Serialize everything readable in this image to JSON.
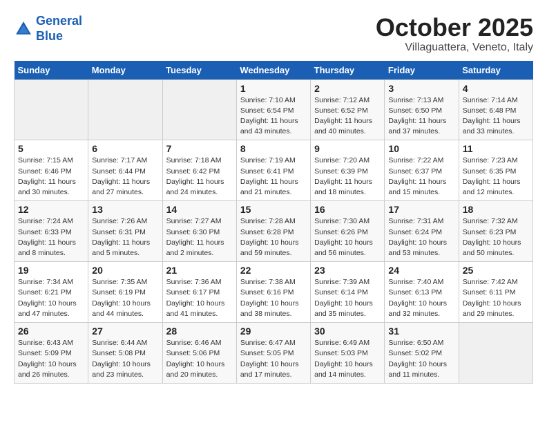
{
  "header": {
    "logo_line1": "General",
    "logo_line2": "Blue",
    "month": "October 2025",
    "location": "Villaguattera, Veneto, Italy"
  },
  "weekdays": [
    "Sunday",
    "Monday",
    "Tuesday",
    "Wednesday",
    "Thursday",
    "Friday",
    "Saturday"
  ],
  "weeks": [
    [
      {
        "day": "",
        "info": ""
      },
      {
        "day": "",
        "info": ""
      },
      {
        "day": "",
        "info": ""
      },
      {
        "day": "1",
        "info": "Sunrise: 7:10 AM\nSunset: 6:54 PM\nDaylight: 11 hours and 43 minutes."
      },
      {
        "day": "2",
        "info": "Sunrise: 7:12 AM\nSunset: 6:52 PM\nDaylight: 11 hours and 40 minutes."
      },
      {
        "day": "3",
        "info": "Sunrise: 7:13 AM\nSunset: 6:50 PM\nDaylight: 11 hours and 37 minutes."
      },
      {
        "day": "4",
        "info": "Sunrise: 7:14 AM\nSunset: 6:48 PM\nDaylight: 11 hours and 33 minutes."
      }
    ],
    [
      {
        "day": "5",
        "info": "Sunrise: 7:15 AM\nSunset: 6:46 PM\nDaylight: 11 hours and 30 minutes."
      },
      {
        "day": "6",
        "info": "Sunrise: 7:17 AM\nSunset: 6:44 PM\nDaylight: 11 hours and 27 minutes."
      },
      {
        "day": "7",
        "info": "Sunrise: 7:18 AM\nSunset: 6:42 PM\nDaylight: 11 hours and 24 minutes."
      },
      {
        "day": "8",
        "info": "Sunrise: 7:19 AM\nSunset: 6:41 PM\nDaylight: 11 hours and 21 minutes."
      },
      {
        "day": "9",
        "info": "Sunrise: 7:20 AM\nSunset: 6:39 PM\nDaylight: 11 hours and 18 minutes."
      },
      {
        "day": "10",
        "info": "Sunrise: 7:22 AM\nSunset: 6:37 PM\nDaylight: 11 hours and 15 minutes."
      },
      {
        "day": "11",
        "info": "Sunrise: 7:23 AM\nSunset: 6:35 PM\nDaylight: 11 hours and 12 minutes."
      }
    ],
    [
      {
        "day": "12",
        "info": "Sunrise: 7:24 AM\nSunset: 6:33 PM\nDaylight: 11 hours and 8 minutes."
      },
      {
        "day": "13",
        "info": "Sunrise: 7:26 AM\nSunset: 6:31 PM\nDaylight: 11 hours and 5 minutes."
      },
      {
        "day": "14",
        "info": "Sunrise: 7:27 AM\nSunset: 6:30 PM\nDaylight: 11 hours and 2 minutes."
      },
      {
        "day": "15",
        "info": "Sunrise: 7:28 AM\nSunset: 6:28 PM\nDaylight: 10 hours and 59 minutes."
      },
      {
        "day": "16",
        "info": "Sunrise: 7:30 AM\nSunset: 6:26 PM\nDaylight: 10 hours and 56 minutes."
      },
      {
        "day": "17",
        "info": "Sunrise: 7:31 AM\nSunset: 6:24 PM\nDaylight: 10 hours and 53 minutes."
      },
      {
        "day": "18",
        "info": "Sunrise: 7:32 AM\nSunset: 6:23 PM\nDaylight: 10 hours and 50 minutes."
      }
    ],
    [
      {
        "day": "19",
        "info": "Sunrise: 7:34 AM\nSunset: 6:21 PM\nDaylight: 10 hours and 47 minutes."
      },
      {
        "day": "20",
        "info": "Sunrise: 7:35 AM\nSunset: 6:19 PM\nDaylight: 10 hours and 44 minutes."
      },
      {
        "day": "21",
        "info": "Sunrise: 7:36 AM\nSunset: 6:17 PM\nDaylight: 10 hours and 41 minutes."
      },
      {
        "day": "22",
        "info": "Sunrise: 7:38 AM\nSunset: 6:16 PM\nDaylight: 10 hours and 38 minutes."
      },
      {
        "day": "23",
        "info": "Sunrise: 7:39 AM\nSunset: 6:14 PM\nDaylight: 10 hours and 35 minutes."
      },
      {
        "day": "24",
        "info": "Sunrise: 7:40 AM\nSunset: 6:13 PM\nDaylight: 10 hours and 32 minutes."
      },
      {
        "day": "25",
        "info": "Sunrise: 7:42 AM\nSunset: 6:11 PM\nDaylight: 10 hours and 29 minutes."
      }
    ],
    [
      {
        "day": "26",
        "info": "Sunrise: 6:43 AM\nSunset: 5:09 PM\nDaylight: 10 hours and 26 minutes."
      },
      {
        "day": "27",
        "info": "Sunrise: 6:44 AM\nSunset: 5:08 PM\nDaylight: 10 hours and 23 minutes."
      },
      {
        "day": "28",
        "info": "Sunrise: 6:46 AM\nSunset: 5:06 PM\nDaylight: 10 hours and 20 minutes."
      },
      {
        "day": "29",
        "info": "Sunrise: 6:47 AM\nSunset: 5:05 PM\nDaylight: 10 hours and 17 minutes."
      },
      {
        "day": "30",
        "info": "Sunrise: 6:49 AM\nSunset: 5:03 PM\nDaylight: 10 hours and 14 minutes."
      },
      {
        "day": "31",
        "info": "Sunrise: 6:50 AM\nSunset: 5:02 PM\nDaylight: 10 hours and 11 minutes."
      },
      {
        "day": "",
        "info": ""
      }
    ]
  ]
}
